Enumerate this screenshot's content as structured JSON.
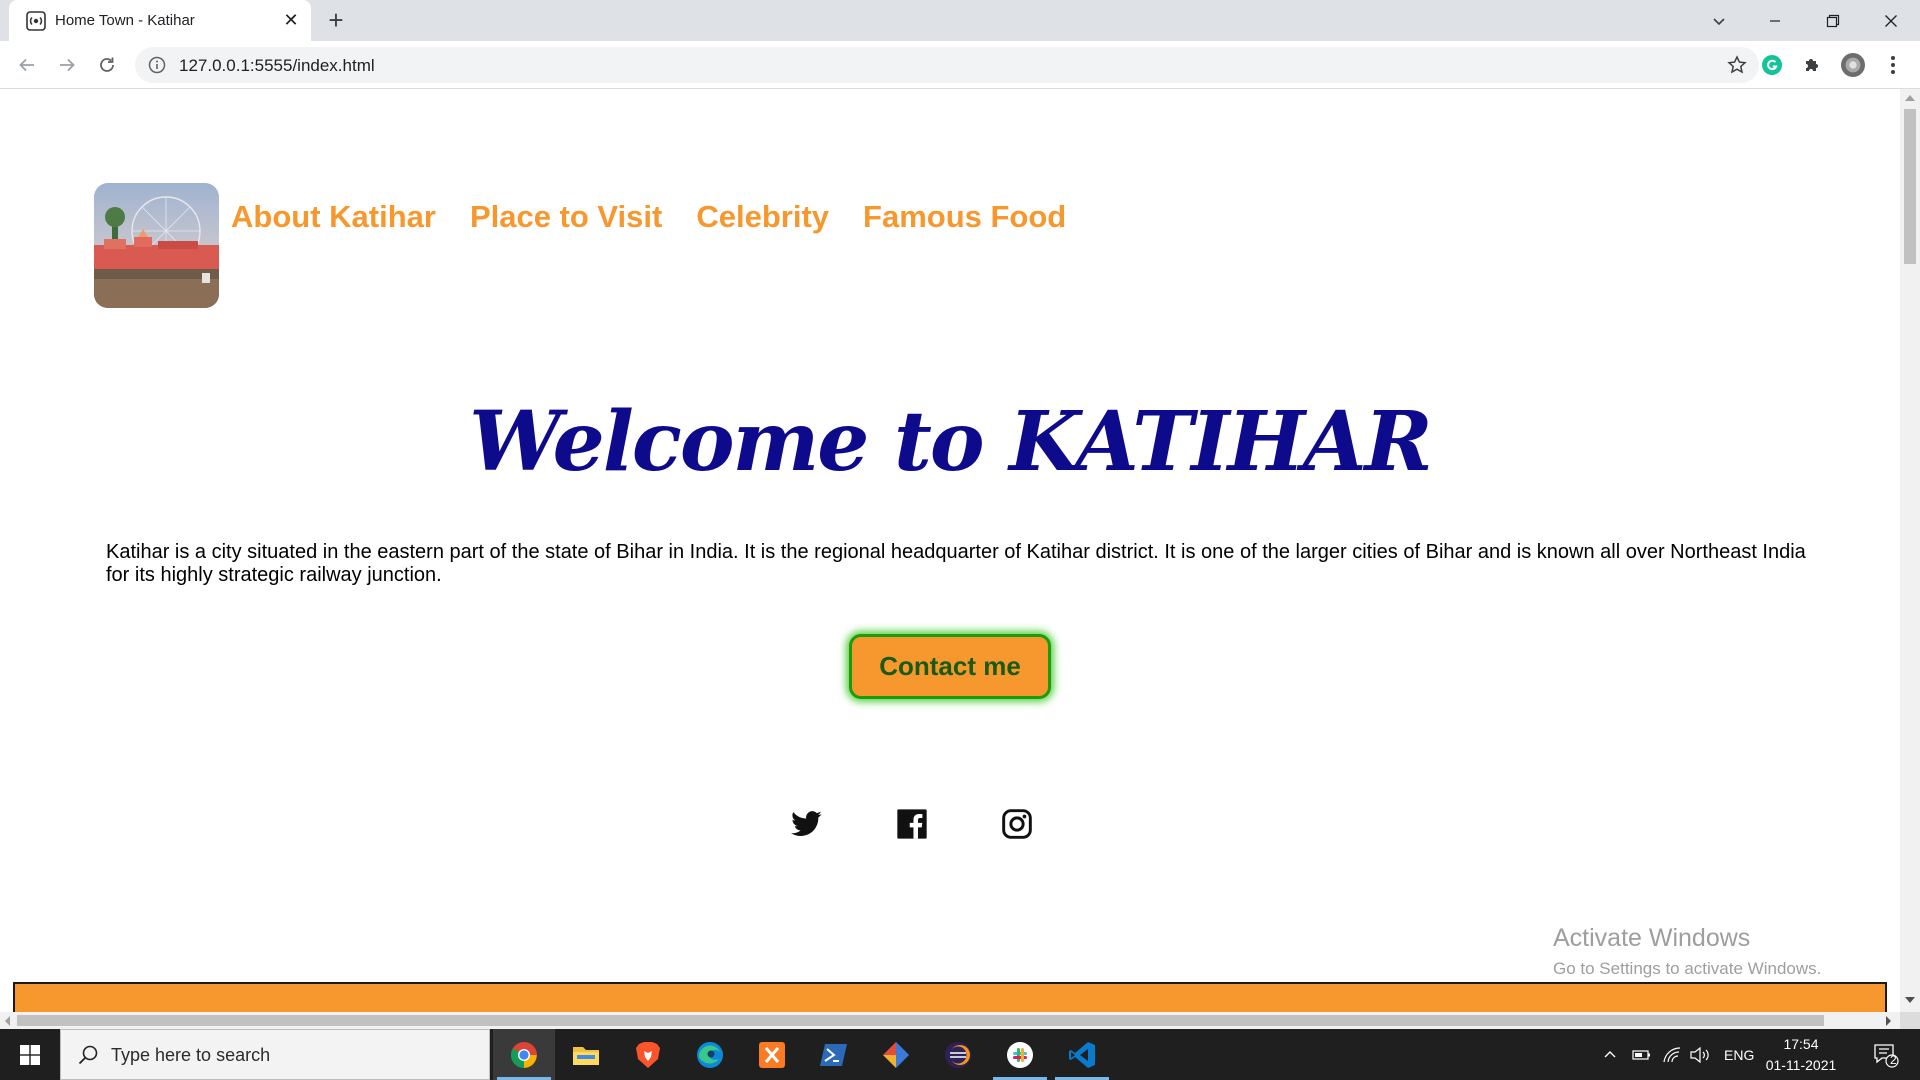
{
  "browser": {
    "tab_title": "Home Town - Katihar",
    "url": "127.0.0.1:5555/index.html"
  },
  "page": {
    "nav": [
      "About Katihar",
      "Place to Visit",
      "Celebrity",
      "Famous Food"
    ],
    "welcome": "Welcome to KATIHAR",
    "intro": "Katihar is a city situated in the eastern part of the state of Bihar in India. It is the regional headquarter of Katihar district. It is one of the larger cities of Bihar and is known all over Northeast India for its highly strategic railway junction.",
    "contact_label": "Contact me",
    "social": [
      "twitter-icon",
      "facebook-icon",
      "instagram-icon"
    ],
    "colors": {
      "accent": "#f7982f",
      "heading": "#0d0a8c",
      "button_border": "#1c9c06"
    }
  },
  "watermark": {
    "title": "Activate Windows",
    "subtitle": "Go to Settings to activate Windows."
  },
  "taskbar": {
    "search_placeholder": "Type here to search",
    "language": "ENG",
    "time": "17:54",
    "date": "01-11-2021",
    "notification_count": "2"
  }
}
